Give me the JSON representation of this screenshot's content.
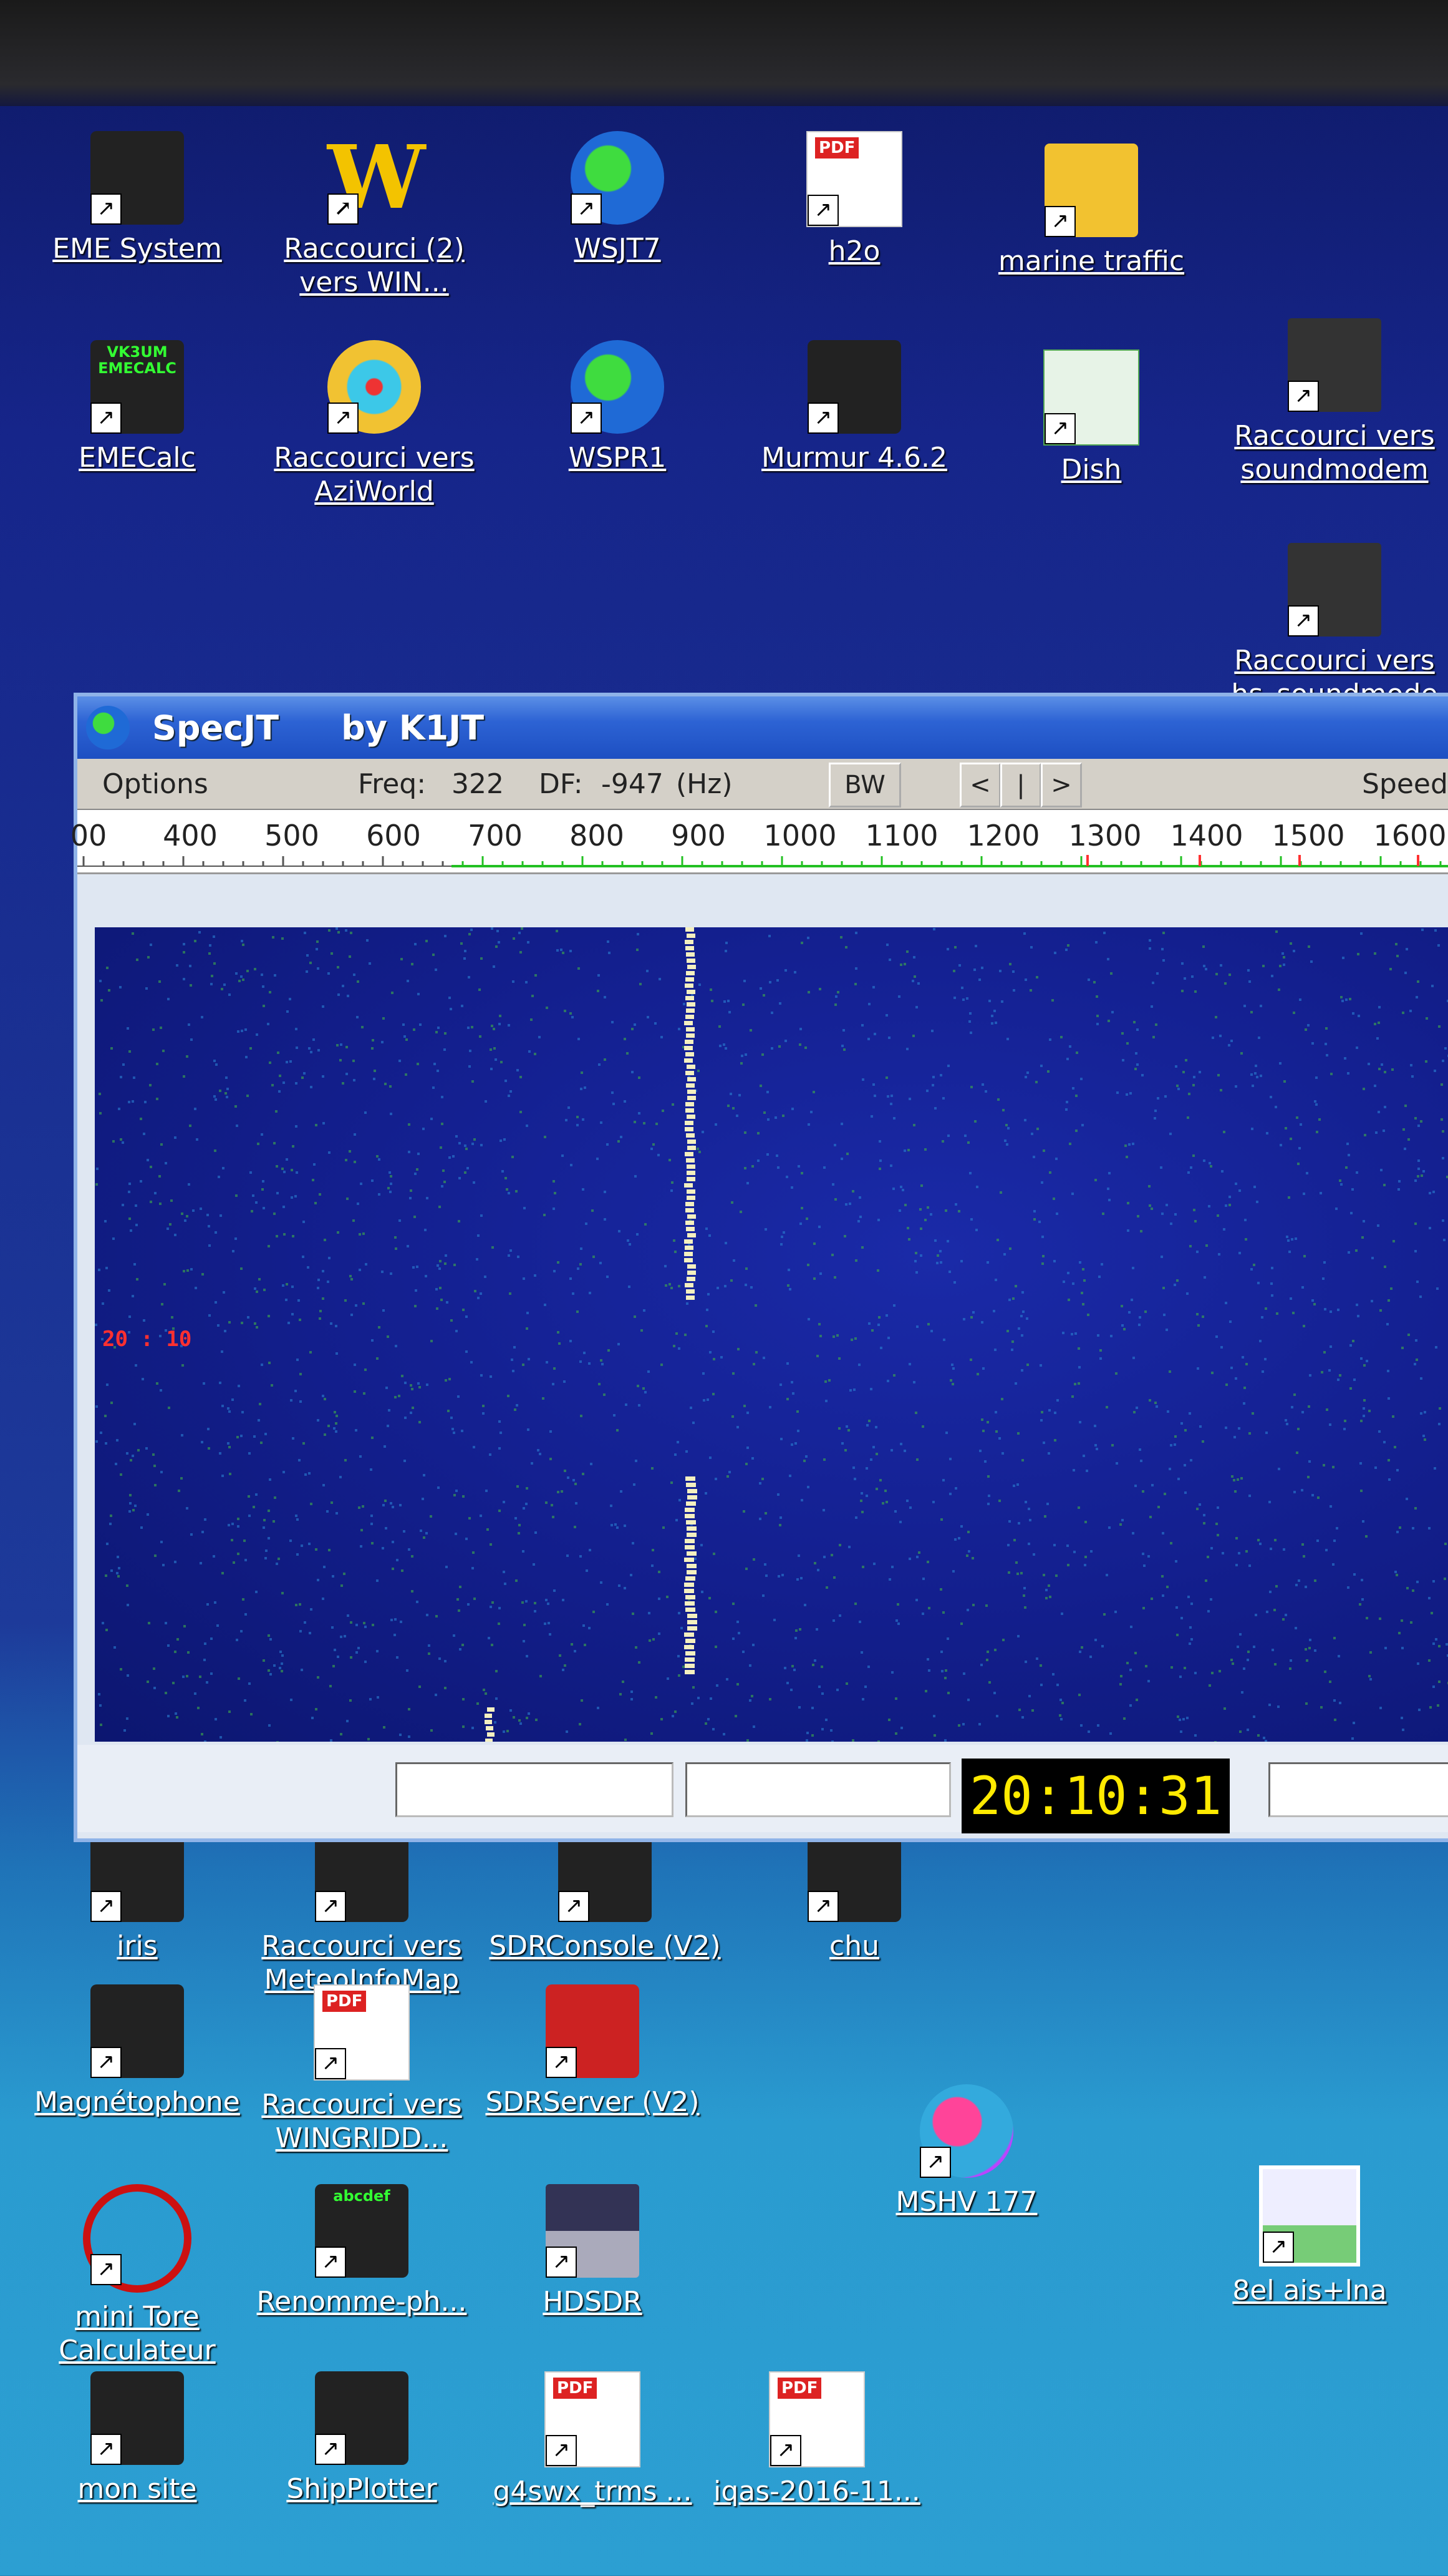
{
  "desktop": {
    "icons_top": [
      {
        "label": "EME System",
        "glyph": "rocket-icon"
      },
      {
        "label": "Raccourci (2)",
        "label2": "vers WIN...",
        "glyph": "w-icon"
      },
      {
        "label": "WSJT7",
        "glyph": "globe-icon"
      },
      {
        "label": "h2o",
        "glyph": "pdf-icon"
      },
      {
        "label": "marine traffic",
        "glyph": "folder-icon"
      },
      {
        "label": "EMECalc",
        "glyph": "kangaroo-icon",
        "badge": "VK3UM EMECALC"
      },
      {
        "label": "Raccourci vers",
        "label2": "AziWorld",
        "glyph": "compass-icon"
      },
      {
        "label": "WSPR1",
        "glyph": "globe-icon"
      },
      {
        "label": "Murmur 4.6.2",
        "glyph": "murmur-icon"
      },
      {
        "label": "Dish",
        "glyph": "excel-icon"
      },
      {
        "label": "Raccourci vers",
        "label2": "soundmodem",
        "glyph": "modem-icon"
      },
      {
        "label": "Raccourci vers",
        "label2": "hs_soundmode",
        "glyph": "modem-icon"
      }
    ],
    "icons_bottom": [
      {
        "label": "iris",
        "glyph": "app-icon"
      },
      {
        "label": "Raccourci vers",
        "label2": "MeteoInfoMap",
        "glyph": "grid-icon"
      },
      {
        "label": "SDRConsole (V2)",
        "glyph": "sdr-icon"
      },
      {
        "label": "chu",
        "glyph": "app-icon"
      },
      {
        "label": "Magnétophone",
        "glyph": "speaker-icon"
      },
      {
        "label": "Raccourci vers",
        "label2": "WINGRIDD...",
        "glyph": "pdf-icon"
      },
      {
        "label": "SDRServer (V2)",
        "glyph": "sdr-server-icon"
      },
      {
        "label": "MSHV 177",
        "glyph": "orb-icon"
      },
      {
        "label": "8el ais+lna",
        "glyph": "image-icon"
      },
      {
        "label": "mini Tore",
        "label2": "Calculateur",
        "glyph": "ring-icon"
      },
      {
        "label": "Renomme-ph...",
        "glyph": "rename-icon",
        "badge": "abcdef"
      },
      {
        "label": "HDSDR",
        "glyph": "hdsdr-icon"
      },
      {
        "label": "mon site",
        "glyph": "firefox-icon"
      },
      {
        "label": "ShipPlotter",
        "glyph": "ship-icon"
      },
      {
        "label": "g4swx_trms ...",
        "glyph": "pdf-icon"
      },
      {
        "label": "iqas-2016-11...",
        "glyph": "pdf-icon"
      }
    ]
  },
  "window": {
    "title": "SpecJT",
    "subtitle": "by K1JT",
    "toolbar": {
      "options": "Options",
      "freq_label": "Freq:",
      "freq_value": "322",
      "df_label": "DF:",
      "df_value": "-947",
      "df_unit": "(Hz)",
      "bw_button": "BW",
      "prev_button": "<",
      "mid_button": "|",
      "next_button": ">",
      "speed_label": "Speed"
    },
    "ruler_ticks": [
      "00",
      "400",
      "500",
      "600",
      "700",
      "800",
      "900",
      "1000",
      "1100",
      "1200",
      "1300",
      "1400",
      "1500",
      "1600"
    ],
    "time_marker": "20 : 10",
    "clock": "20:10:31"
  },
  "colors": {
    "signal": "#f4f0c0",
    "marker": "#ff3030",
    "clock_text": "#ffea00",
    "scale_green": "#22c022"
  }
}
